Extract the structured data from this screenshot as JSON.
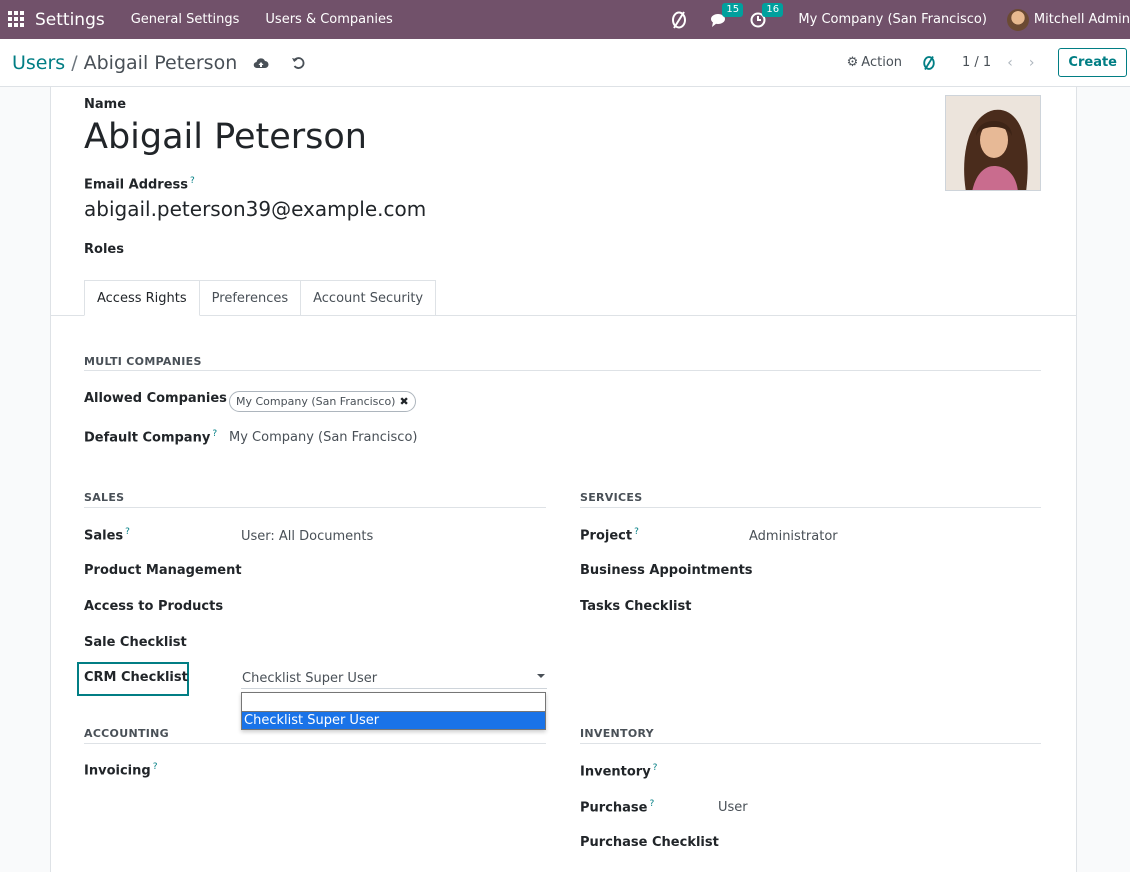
{
  "navbar": {
    "brand": "Settings",
    "menu": [
      "General Settings",
      "Users & Companies"
    ],
    "chat_badge": "15",
    "activity_badge": "16",
    "company": "My Company (San Francisco)",
    "user": "Mitchell Admin"
  },
  "control_panel": {
    "breadcrumb_parent": "Users",
    "breadcrumb_sep": "/",
    "breadcrumb_current": "Abigail Peterson",
    "action_label": "Action",
    "pager": "1 / 1",
    "create_label": "Create"
  },
  "form": {
    "name_label": "Name",
    "name_value": "Abigail Peterson",
    "email_label": "Email Address",
    "email_value": "abigail.peterson39@example.com",
    "roles_label": "Roles",
    "help_mark": "?",
    "tabs": [
      "Access Rights",
      "Preferences",
      "Account Security"
    ],
    "multi_companies": {
      "title": "MULTI COMPANIES",
      "allowed_label": "Allowed Companies",
      "allowed_tag": "My Company (San Francisco)",
      "default_label": "Default Company",
      "default_value": "My Company (San Francisco)"
    },
    "sales": {
      "title": "SALES",
      "sales_label": "Sales",
      "sales_value": "User: All Documents",
      "product_mgmt_label": "Product Management",
      "access_products_label": "Access to Products",
      "sale_checklist_label": "Sale Checklist",
      "crm_checklist_label": "CRM Checklist",
      "crm_checklist_value": "Checklist Super User"
    },
    "services": {
      "title": "SERVICES",
      "project_label": "Project",
      "project_value": "Administrator",
      "business_appt_label": "Business Appointments",
      "tasks_checklist_label": "Tasks Checklist"
    },
    "accounting": {
      "title": "ACCOUNTING",
      "invoicing_label": "Invoicing"
    },
    "inventory": {
      "title": "INVENTORY",
      "inventory_label": "Inventory",
      "purchase_label": "Purchase",
      "purchase_value": "User",
      "purchase_checklist_label": "Purchase Checklist"
    },
    "dropdown_options": [
      "Checklist Super User"
    ]
  },
  "colors": {
    "navbar": "#71516a",
    "accent": "#017e84",
    "badge": "#00a09d",
    "selected_option": "#1a73e8"
  }
}
